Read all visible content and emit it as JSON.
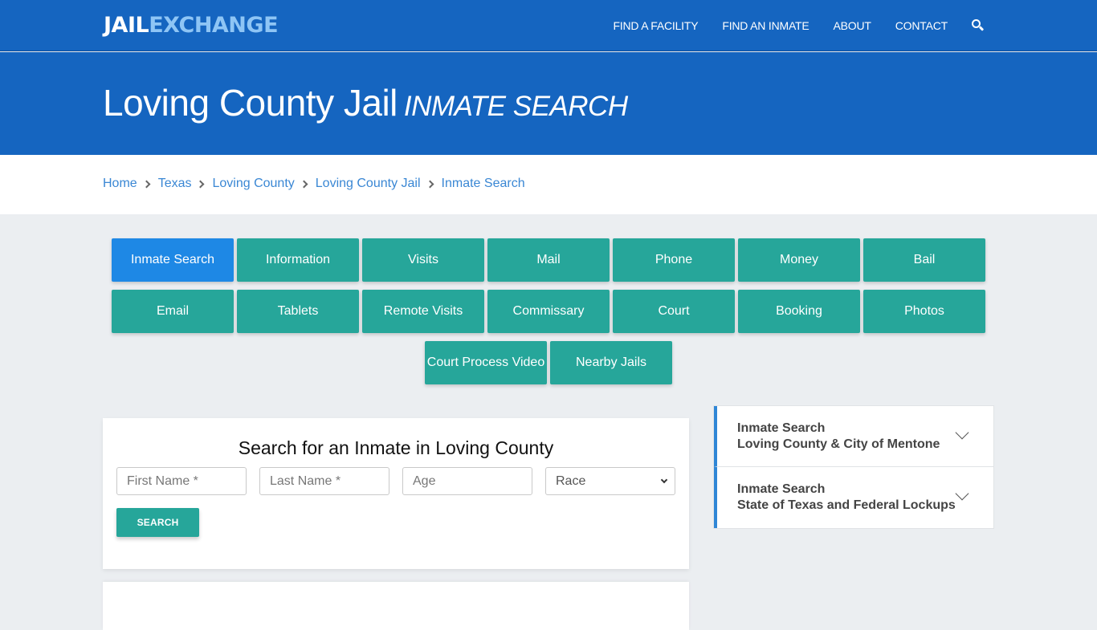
{
  "header": {
    "logo_part1": "JAIL",
    "logo_part2": "EXCHANGE",
    "nav": [
      "FIND A FACILITY",
      "FIND AN INMATE",
      "ABOUT",
      "CONTACT"
    ],
    "search_icon": "search-icon"
  },
  "hero": {
    "title": "Loving County Jail",
    "subtitle": "INMATE SEARCH"
  },
  "breadcrumb": [
    "Home",
    "Texas",
    "Loving County",
    "Loving County Jail",
    "Inmate Search"
  ],
  "tabs": {
    "active": "Inmate Search",
    "items": [
      "Inmate Search",
      "Information",
      "Visits",
      "Mail",
      "Phone",
      "Money",
      "Bail",
      "Email",
      "Tablets",
      "Remote Visits",
      "Commissary",
      "Court",
      "Booking",
      "Photos",
      "Court Process Video",
      "Nearby Jails"
    ]
  },
  "search_form": {
    "heading": "Search for an Inmate in Loving County",
    "first_name_placeholder": "First Name *",
    "last_name_placeholder": "Last Name *",
    "age_placeholder": "Age",
    "race_selected": "Race",
    "search_label": "SEARCH"
  },
  "sidebar": {
    "items": [
      {
        "line1": "Inmate Search",
        "line2": "Loving County & City of Mentone"
      },
      {
        "line1": "Inmate Search",
        "line2": "State of Texas and Federal Lockups"
      }
    ]
  },
  "colors": {
    "primary_blue": "#1565c0",
    "logo_light_blue": "#8ec5f5",
    "teal": "#26a69a",
    "active_tab_blue": "#1e88e5",
    "link_blue": "#3a87d4",
    "background": "#ebeef1"
  }
}
